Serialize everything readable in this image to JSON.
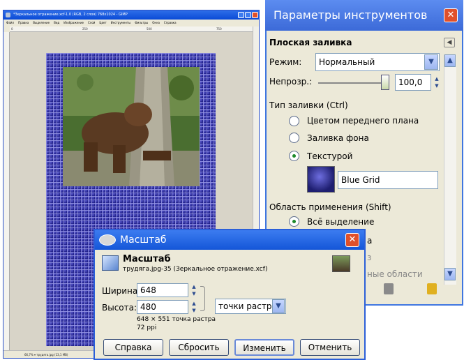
{
  "gimp": {
    "title": "*Зеркальное отражение.xcf-1.0 (RGB, 2 слоя) 768x1024 - GIMP",
    "menu": [
      "Файл",
      "Правка",
      "Выделение",
      "Вид",
      "Изображение",
      "Слой",
      "Цвет",
      "Инструменты",
      "Фильтры",
      "Окна",
      "Справка"
    ],
    "ruler_marks": [
      "0",
      "250",
      "500",
      "750"
    ],
    "status": "66,7% ▾ трудяга.jpg (13,1 MB)"
  },
  "dock": {
    "title": "Параметры инструментов",
    "tool_name": "Плоская заливка",
    "mode_label": "Режим:",
    "mode_value": "Нормальный",
    "opacity_label": "Непрозр.:",
    "opacity_value": "100,0",
    "fill_type_label": "Тип заливки (Ctrl)",
    "fill_options": [
      "Цветом переднего плана",
      "Заливка фона",
      "Текстурой"
    ],
    "fill_selected": "Текстурой",
    "pattern_name": "Blue Grid",
    "area_label": "Область применения (Shift)",
    "area_options": [
      "Всё выделение",
      "ные области"
    ],
    "area_partial": "а",
    "area_partial2": "з"
  },
  "scale": {
    "title": "Масштаб",
    "heading": "Масштаб",
    "subtitle": "трудяга.jpg-35 (Зеркальное отражение.xcf)",
    "width_label": "Ширина:",
    "width_value": "648",
    "height_label": "Высота:",
    "height_value": "480",
    "unit": "точки растра",
    "info_size": "648 × 551 точка растра",
    "info_ppi": "72 ppi",
    "buttons": {
      "help": "Справка",
      "reset": "Сбросить",
      "scale": "Изменить",
      "cancel": "Отменить"
    }
  },
  "colors": {
    "xp_blue": "#0a4ad6",
    "grid_blue": "#1a1a7a",
    "close_red": "#e0502a"
  }
}
